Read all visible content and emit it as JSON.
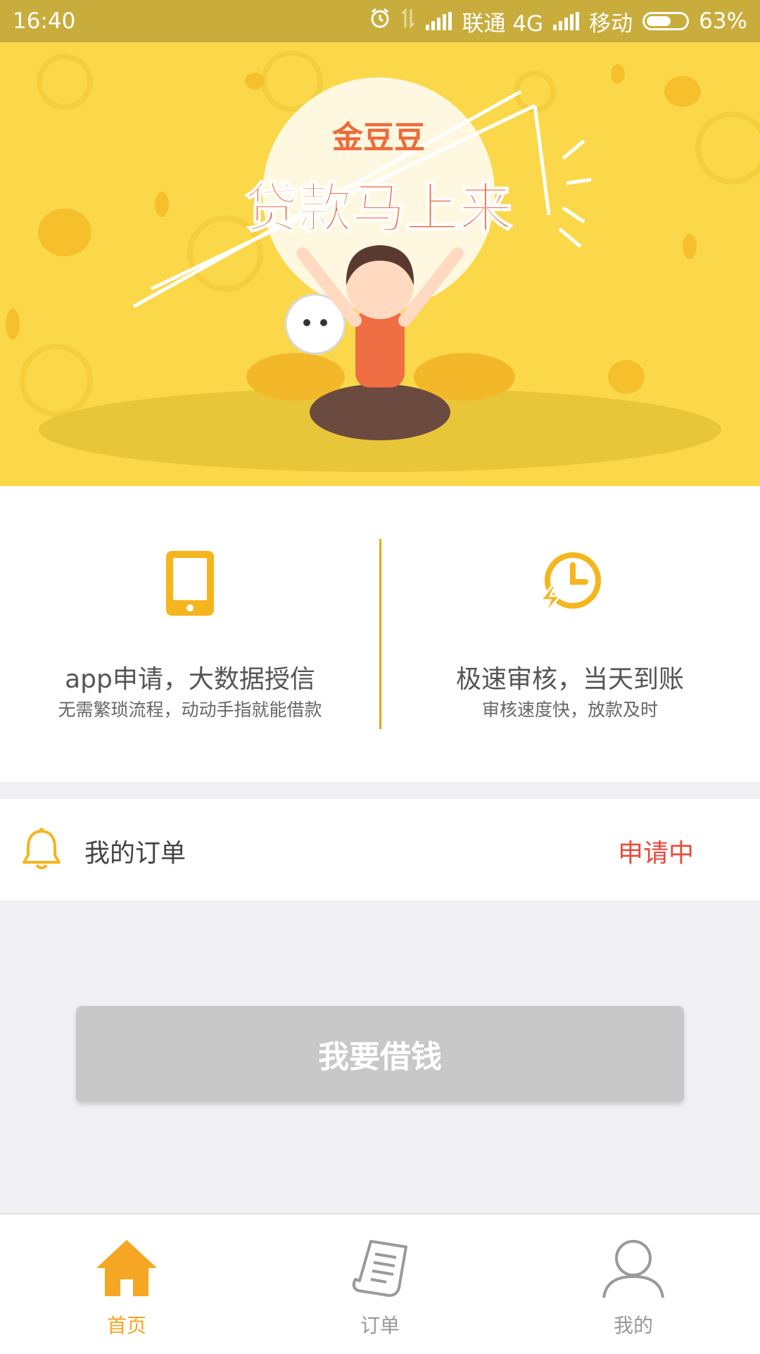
{
  "status_bar": {
    "time": "16:40",
    "carrier1": "联通 4G",
    "carrier2": "移动",
    "battery": "63%",
    "battery_level": 0.63
  },
  "banner": {
    "brand": "金豆豆",
    "slogan": "贷款马上来"
  },
  "features": [
    {
      "icon": "tablet-icon",
      "title": "app申请，大数据授信",
      "subtitle": "无需繁琐流程，动动手指就能借款"
    },
    {
      "icon": "clock-lightning-icon",
      "title": "极速审核，当天到账",
      "subtitle": "审核速度快，放款及时"
    }
  ],
  "order": {
    "icon": "bell-icon",
    "label": "我的订单",
    "status": "申请中"
  },
  "borrow_button": "我要借钱",
  "tabs": [
    {
      "label": "首页",
      "icon": "home-icon",
      "active": true
    },
    {
      "label": "订单",
      "icon": "receipt-icon",
      "active": false
    },
    {
      "label": "我的",
      "icon": "user-icon",
      "active": false
    }
  ],
  "colors": {
    "accent": "#f5a623",
    "status_red": "#e84a3b",
    "banner_yellow": "#fbd84a",
    "status_bar": "#c9ad3c",
    "button_disabled": "#c8c8c8",
    "tab_inactive": "#999999"
  }
}
